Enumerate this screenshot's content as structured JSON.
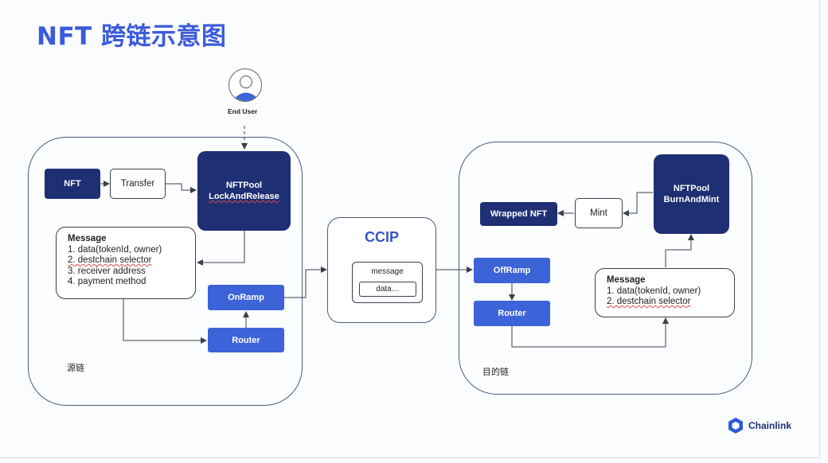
{
  "title": "NFT 跨链示意图",
  "end_user": {
    "label": "End User"
  },
  "source_chain": {
    "label": "源链",
    "nft": "NFT",
    "transfer": "Transfer",
    "pool_line1": "NFTPool",
    "pool_line2": "LockAndRelease",
    "message": {
      "title": "Message",
      "items": [
        "1. data(tokenId, owner)",
        "2. destchain selector",
        "3. receiver address",
        "4. payment method"
      ]
    },
    "onramp": "OnRamp",
    "router": "Router"
  },
  "ccip": {
    "title": "CCIP",
    "message": "message",
    "data": "data…"
  },
  "dest_chain": {
    "label": "目的链",
    "wrapped_nft": "Wrapped NFT",
    "mint": "Mint",
    "pool_line1": "NFTPool",
    "pool_line2": "BurnAndMint",
    "message": {
      "title": "Message",
      "items": [
        "1. data(tokenId, owner)",
        "2. destchain selector"
      ]
    },
    "offramp": "OffRamp",
    "router": "Router"
  },
  "brand": {
    "name": "Chainlink"
  },
  "colors": {
    "title": "#3b5bdb",
    "dark_node": "#1f2f73",
    "blue_node": "#3d63d8",
    "border": "#4a5a7d"
  }
}
